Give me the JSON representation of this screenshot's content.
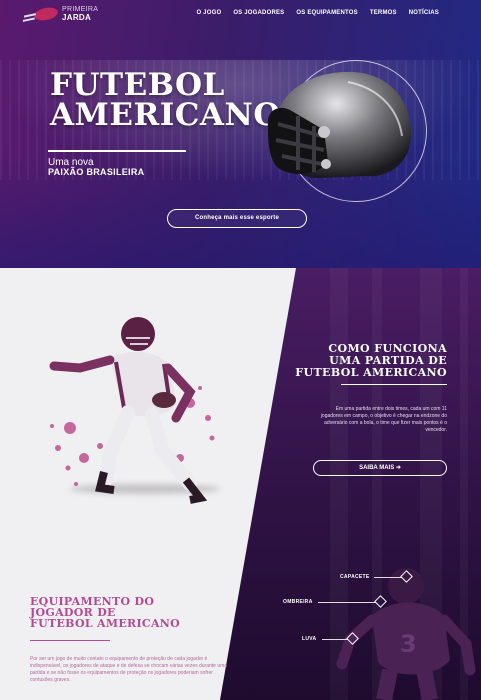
{
  "brand": {
    "top": "PRIMEIRA",
    "bottom": "JARDA"
  },
  "nav": [
    "O JOGO",
    "OS JOGADORES",
    "OS EQUIPAMENTOS",
    "TERMOS",
    "NOTÍCIAS"
  ],
  "hero": {
    "title_line1": "FUTEBOL",
    "title_line2": "AMERICANO",
    "subtitle": "Uma nova",
    "subtitle2": "PAIXÃO BRASILEIRA",
    "cta": "Conheça mais esse esporte"
  },
  "how": {
    "title_lines": [
      "COMO FUNCIONA",
      "UMA PARTIDA DE",
      "FUTEBOL AMERICANO"
    ],
    "text": "Em uma partida entre dois times, cada um com 11 jogadores em campo, o objetivo é chegar na endzone do adversário com a bola, o time que fizer mais pontos é o vencedor.",
    "button": "SAIBA MAIS ➜"
  },
  "equipment": {
    "title_lines": [
      "EQUIPAMENTO DO",
      "JOGADOR DE",
      "FUTEBOL AMERICANO"
    ],
    "text": "Por ser um jogo de muito contato o equipamento de proteção de cada jogador é indispensável, os jogadores de ataque e de defesa se chocam várias vezes durante uma partida e se não fosse os equipamentos de proteção os jogadores poderiam sofrer contusões graves.",
    "labels": {
      "capacete": "CAPACETE",
      "ombreira": "OMBREIRA",
      "luva": "LUVA"
    }
  },
  "colors": {
    "accent": "#b44a93",
    "hero_left": "#5a1a6e",
    "hero_right": "#1f2a86",
    "panel": "#2e1244"
  },
  "icons": {
    "logo": "football-icon",
    "helmet": "football-helmet",
    "player1": "football-player-running",
    "player2": "football-player-silhouette"
  }
}
